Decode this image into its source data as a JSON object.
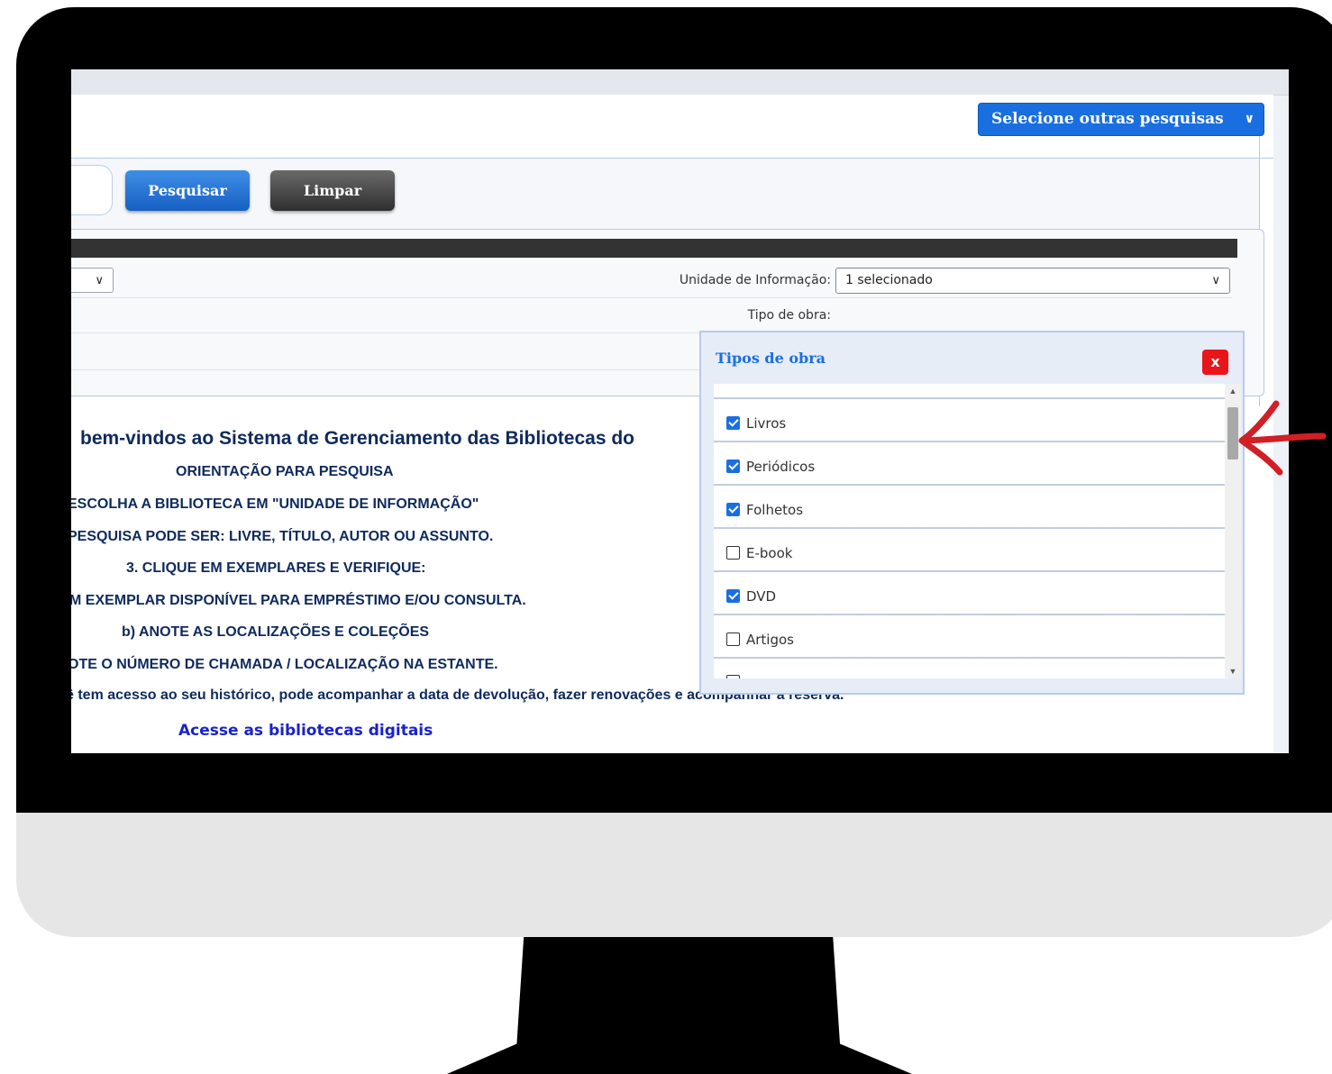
{
  "header": {
    "select_other_label": "Selecione outras pesquisas"
  },
  "search": {
    "search_button": "Pesquisar",
    "clear_button": "Limpar"
  },
  "filters": {
    "unit_label": "Unidade de Informação:",
    "unit_value": "1 selecionado",
    "type_label": "Tipo de obra:"
  },
  "welcome": {
    "title": "bem-vindos ao Sistema de Gerenciamento das Bibliotecas do",
    "lines": [
      "ORIENTAÇÃO PARA PESQUISA",
      "ESCOLHA A BIBLIOTECA EM \"UNIDADE DE INFORMAÇÃO\"",
      "PESQUISA PODE SER: LIVRE, TÍTULO, AUTOR OU ASSUNTO.",
      "3. CLIQUE EM EXEMPLARES E VERIFIQUE:",
      "M EXEMPLAR DISPONÍVEL PARA EMPRÉSTIMO E/OU CONSULTA.",
      "b) ANOTE AS LOCALIZAÇÕES E COLEÇÕES",
      "OTE O NÚMERO DE CHAMADA / LOCALIZAÇÃO NA ESTANTE.",
      "ê tem acesso ao seu histórico, pode acompanhar a data de devolução, fazer renovações e acompanhar a reserva."
    ],
    "link": "Acesse as bibliotecas digitais"
  },
  "popup": {
    "title": "Tipos de obra",
    "close": "x",
    "options": [
      {
        "label": "Livros",
        "checked": true
      },
      {
        "label": "Periódicos",
        "checked": true
      },
      {
        "label": "Folhetos",
        "checked": true
      },
      {
        "label": "E-book",
        "checked": false
      },
      {
        "label": "DVD",
        "checked": true
      },
      {
        "label": "Artigos",
        "checked": false
      }
    ]
  },
  "colors": {
    "accent": "#1a6fe0",
    "close": "#e8151b",
    "text_dark": "#0e2a5c",
    "annotation": "#d11f26"
  }
}
